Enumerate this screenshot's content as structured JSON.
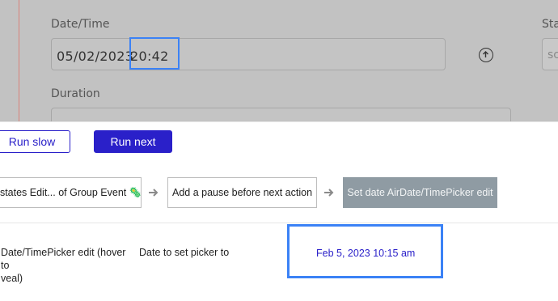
{
  "form": {
    "datetime_label": "Date/Time",
    "datetime_date": "05/02/2023",
    "datetime_time": "20:42",
    "status_label": "Sta",
    "status_value": "sc",
    "duration_label": "Duration",
    "upload_icon": "upload-circle-icon"
  },
  "controls": {
    "run_slow_label": "Run slow",
    "run_next_label": "Run next"
  },
  "steps": [
    {
      "label": "t states Edit... of Group Event 🦠"
    },
    {
      "label": "Add a pause before next action"
    },
    {
      "label": "Set date AirDate/TimePicker edit"
    }
  ],
  "step_arrow_icon": "arrow-right-icon",
  "detail_row": {
    "description": "Date/TimePicker edit (hover to\nveal)",
    "field": "Date to set picker to",
    "value": "Feb 5, 2023 10:15 am"
  },
  "colors": {
    "accent": "#2a20c9",
    "highlight": "#3b82f6",
    "active_step": "#8f9ba3"
  }
}
